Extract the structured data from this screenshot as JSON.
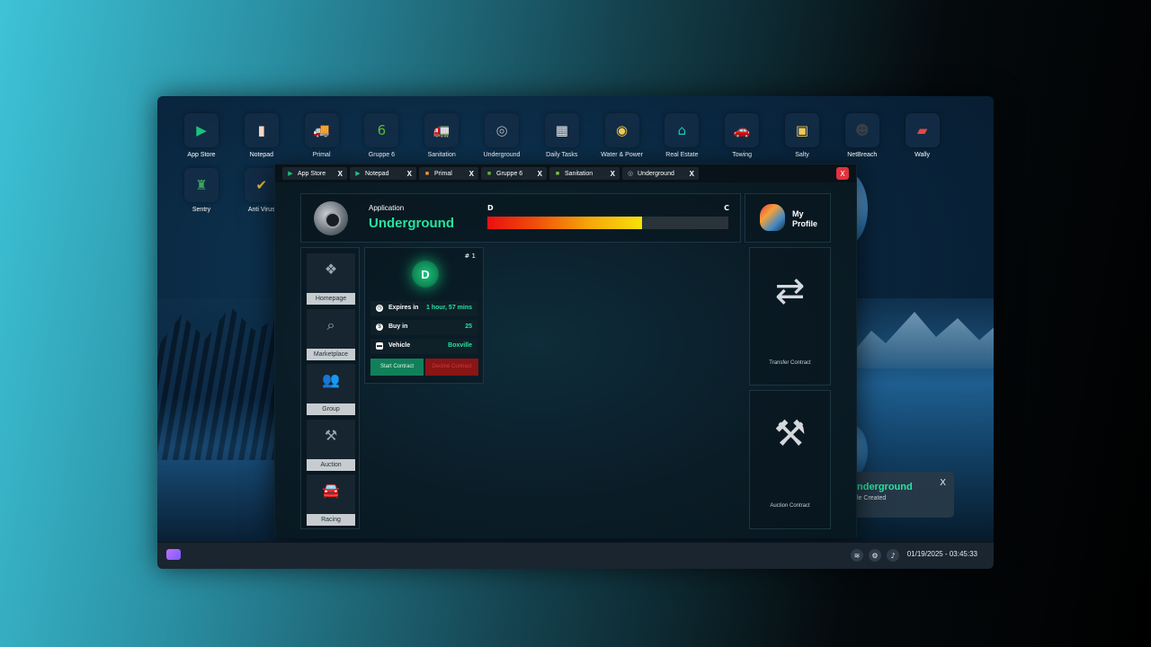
{
  "desktop": {
    "icons_row1": [
      {
        "label": "App Store",
        "icon": "play-icon",
        "glyph": "▶",
        "color": "#19c37d"
      },
      {
        "label": "Notepad",
        "icon": "notepad-icon",
        "glyph": "▮",
        "color": "#f3d7c0"
      },
      {
        "label": "Primal",
        "icon": "truck-icon",
        "glyph": "🚚",
        "color": "#f59b2a"
      },
      {
        "label": "Gruppe 6",
        "icon": "shield-6-icon",
        "glyph": "6",
        "color": "#5fb838"
      },
      {
        "label": "Sanitation",
        "icon": "garbage-truck-icon",
        "glyph": "🚛",
        "color": "#7fc241"
      },
      {
        "label": "Underground",
        "icon": "turbo-icon",
        "glyph": "◎",
        "color": "#b0b6bb"
      },
      {
        "label": "Daily Tasks",
        "icon": "calendar-icon",
        "glyph": "▦",
        "color": "#e8ecef"
      },
      {
        "label": "Water & Power",
        "icon": "water-power-icon",
        "glyph": "◉",
        "color": "#f2c94c"
      },
      {
        "label": "Real Estate",
        "icon": "house-icon",
        "glyph": "⌂",
        "color": "#1fc7b2"
      },
      {
        "label": "Towing",
        "icon": "tow-truck-icon",
        "glyph": "🚗",
        "color": "#e53b3b"
      },
      {
        "label": "Salty",
        "icon": "salty-icon",
        "glyph": "▣",
        "color": "#f0c95a"
      },
      {
        "label": "NetBreach",
        "icon": "mask-icon",
        "glyph": "☻",
        "color": "#3a3f44"
      },
      {
        "label": "Wally",
        "icon": "wallet-icon",
        "glyph": "▰",
        "color": "#e04848"
      }
    ],
    "icons_row2": [
      {
        "label": "Sentry",
        "icon": "sentry-icon",
        "glyph": "♜",
        "color": "#3ba55c"
      },
      {
        "label": "Anti Virus",
        "icon": "antivirus-shield-icon",
        "glyph": "✔",
        "color": "#e7b93a"
      }
    ]
  },
  "notification": {
    "title": "nderground",
    "subtitle": "le Created",
    "close": "X"
  },
  "taskbar": {
    "datetime": "01/19/2025 - 03:45:33"
  },
  "window": {
    "tabs": [
      {
        "label": "App Store",
        "icon": "play-icon",
        "glyph": "▶",
        "color": "#19c37d",
        "close": "X"
      },
      {
        "label": "Notepad",
        "icon": "play-icon",
        "glyph": "▶",
        "color": "#19c37d",
        "close": "X"
      },
      {
        "label": "Primal",
        "icon": "truck-icon",
        "glyph": "■",
        "color": "#f59b2a",
        "close": "X"
      },
      {
        "label": "Gruppe 6",
        "icon": "shield-6-icon",
        "glyph": "■",
        "color": "#5fb838",
        "close": "X"
      },
      {
        "label": "Sanitation",
        "icon": "garbage-truck-icon",
        "glyph": "■",
        "color": "#7fc241",
        "close": "X"
      },
      {
        "label": "Underground",
        "icon": "turbo-icon",
        "glyph": "◎",
        "color": "#b0b6bb",
        "close": "X"
      }
    ],
    "close": "X"
  },
  "app": {
    "label": "Application",
    "name": "Underground",
    "rank_current": "D",
    "rank_next": "C",
    "rank_progress": 0.64,
    "profile_label": "My Profile",
    "nav": [
      {
        "label": "Homepage",
        "icon": "boxes-icon",
        "glyph": "❖"
      },
      {
        "label": "Marketplace",
        "icon": "marketplace-search-icon",
        "glyph": "⌕"
      },
      {
        "label": "Group",
        "icon": "group-icon",
        "glyph": "👥"
      },
      {
        "label": "Auction",
        "icon": "gavel-icon",
        "glyph": "⚒"
      },
      {
        "label": "Racing",
        "icon": "car-icon",
        "glyph": "🚘"
      }
    ],
    "contract": {
      "number": "# 1",
      "grade": "D",
      "expires_label": "Expires in",
      "expires_value": "1 hour, 57 mins",
      "buyin_label": "Buy in",
      "buyin_value": "25",
      "vehicle_label": "Vehicle",
      "vehicle_value": "Boxville",
      "start_label": "Start Contract",
      "decline_label": "Decline Contract"
    },
    "actions": {
      "transfer_label": "Transfer Contract",
      "auction_label": "Auction Contract"
    }
  }
}
